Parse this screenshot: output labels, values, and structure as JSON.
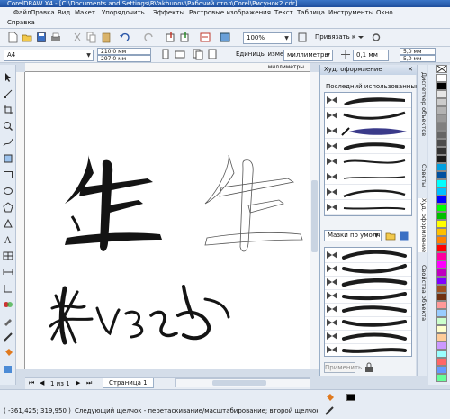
{
  "window": {
    "title": "CorelDRAW X4 - [C:\\Documents and Settings\\RVakhunov\\Рабочий стол\\Corel\\Рисунок2.cdr]"
  },
  "menu": {
    "items": [
      "Файл",
      "Правка",
      "Вид",
      "Макет",
      "Упорядочить",
      "Эффекты",
      "Растровые изображения",
      "Текст",
      "Таблица",
      "Инструменты",
      "Окно"
    ],
    "row2": [
      "Справка"
    ]
  },
  "toolbar": {
    "zoom": "100%",
    "snap_label": "Привязать к"
  },
  "props": {
    "paper": "A4",
    "width": "210,0 мм",
    "height": "297,0 мм",
    "units_label": "Единицы измерения:",
    "units_value": "миллиметры",
    "nudge": "0,1 мм",
    "dup_x": "5,0 мм",
    "dup_y": "5,0 мм"
  },
  "ruler": {
    "units": "миллиметры"
  },
  "pagenav": {
    "page_counter": "1 из 1",
    "page_tab": "Страница 1"
  },
  "docker": {
    "title": "Худ. оформление",
    "recent_label": "Последний использованный:",
    "mask_combo": "Мазки по умолч...",
    "apply_label": "Применить"
  },
  "vtabs": [
    "Диспетчер объектов",
    "Советы",
    "Худ. оформление",
    "Свойства объекта"
  ],
  "status": {
    "coords": "( -361,425; 319,950 )",
    "hint": "Следующий щелчок - перетаскивание/масштабирование; второй щелчок - поворот/на..."
  },
  "palette_colors": [
    "#ffffff",
    "#000000",
    "#e6e6e6",
    "#cccccc",
    "#b3b3b3",
    "#999999",
    "#808080",
    "#666666",
    "#4d4d4d",
    "#333333",
    "#1a1a1a",
    "#00a0e0",
    "#0050a0",
    "#00ffff",
    "#00c0ff",
    "#0000ff",
    "#00ff00",
    "#00c000",
    "#ffff00",
    "#ffc000",
    "#ff8000",
    "#ff0000",
    "#ff00a0",
    "#ff00ff",
    "#c000c0",
    "#8000ff",
    "#a05020",
    "#703010",
    "#ff9999",
    "#99ccff",
    "#ccffcc",
    "#ffffcc",
    "#ffcc99",
    "#cc99ff",
    "#99ffff",
    "#ff6666",
    "#6699ff",
    "#66ff99"
  ]
}
